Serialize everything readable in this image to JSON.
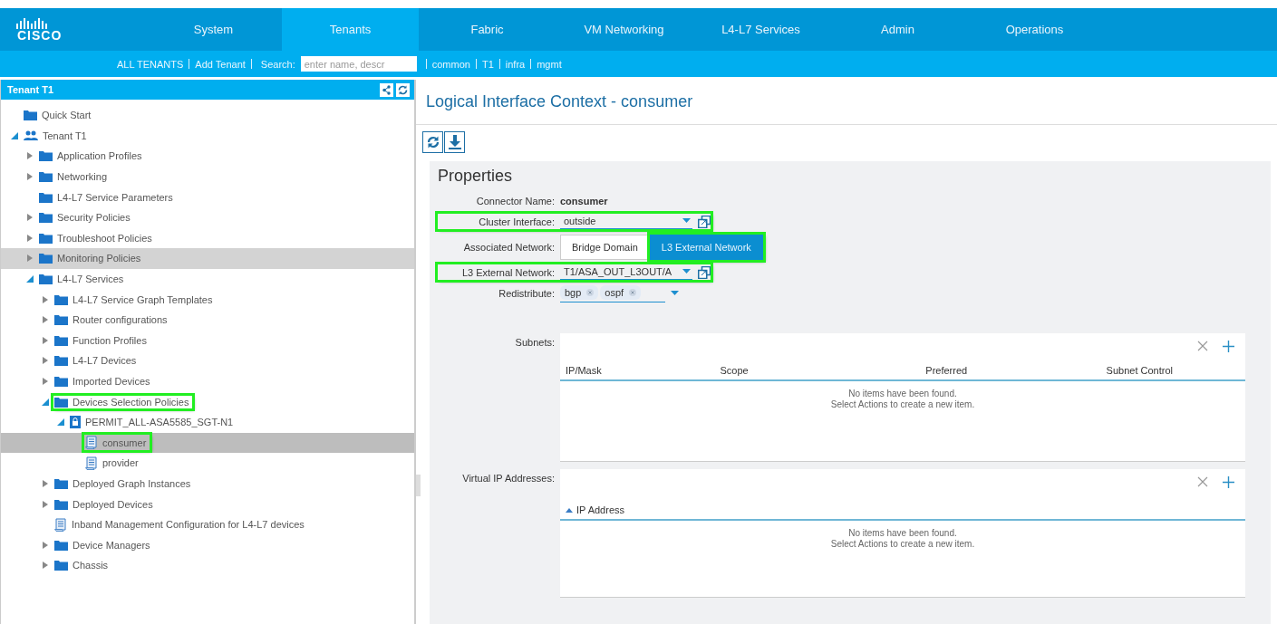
{
  "logo_text": "CISCO",
  "nav": [
    {
      "label": "System",
      "selected": false
    },
    {
      "label": "Tenants",
      "selected": true
    },
    {
      "label": "Fabric",
      "selected": false
    },
    {
      "label": "VM Networking",
      "selected": false
    },
    {
      "label": "L4-L7 Services",
      "selected": false
    },
    {
      "label": "Admin",
      "selected": false
    },
    {
      "label": "Operations",
      "selected": false
    }
  ],
  "subnav": {
    "links": [
      "ALL TENANTS",
      "Add Tenant"
    ],
    "search_label": "Search:",
    "search_placeholder": "enter name, descr",
    "tenants": [
      "common",
      "T1",
      "infra",
      "mgmt"
    ]
  },
  "sidebar": {
    "title": "Tenant T1",
    "tree": [
      {
        "label": "Quick Start",
        "kind": "folder",
        "selected": false,
        "hover": false,
        "highlighted": false
      },
      {
        "label": "Tenant T1",
        "kind": "tenant",
        "expanded": true,
        "selected": false,
        "hover": false,
        "highlighted": false,
        "children": [
          {
            "label": "Application Profiles",
            "kind": "folder",
            "expanded": false,
            "selected": false,
            "hover": false,
            "highlighted": false
          },
          {
            "label": "Networking",
            "kind": "folder",
            "expanded": false,
            "selected": false,
            "hover": false,
            "highlighted": false
          },
          {
            "label": "L4-L7 Service Parameters",
            "kind": "folder",
            "selected": false,
            "hover": false,
            "highlighted": false
          },
          {
            "label": "Security Policies",
            "kind": "folder",
            "expanded": false,
            "selected": false,
            "hover": false,
            "highlighted": false
          },
          {
            "label": "Troubleshoot Policies",
            "kind": "folder",
            "expanded": false,
            "selected": false,
            "hover": false,
            "highlighted": false
          },
          {
            "label": "Monitoring Policies",
            "kind": "folder",
            "expanded": false,
            "selected": false,
            "hover": true,
            "highlighted": false
          },
          {
            "label": "L4-L7 Services",
            "kind": "folder",
            "expanded": true,
            "selected": false,
            "hover": false,
            "highlighted": false,
            "children": [
              {
                "label": "L4-L7 Service Graph Templates",
                "kind": "folder",
                "expanded": false,
                "selected": false,
                "hover": false,
                "highlighted": false
              },
              {
                "label": "Router configurations",
                "kind": "folder",
                "expanded": false,
                "selected": false,
                "hover": false,
                "highlighted": false
              },
              {
                "label": "Function Profiles",
                "kind": "folder",
                "expanded": false,
                "selected": false,
                "hover": false,
                "highlighted": false
              },
              {
                "label": "L4-L7 Devices",
                "kind": "folder",
                "expanded": false,
                "selected": false,
                "hover": false,
                "highlighted": false
              },
              {
                "label": "Imported Devices",
                "kind": "folder",
                "expanded": false,
                "selected": false,
                "hover": false,
                "highlighted": false
              },
              {
                "label": "Devices Selection Policies",
                "kind": "folder",
                "expanded": true,
                "selected": false,
                "hover": false,
                "highlighted": true,
                "children": [
                  {
                    "label": "PERMIT_ALL-ASA5585_SGT-N1",
                    "kind": "policy",
                    "expanded": true,
                    "selected": false,
                    "hover": false,
                    "highlighted": false,
                    "children": [
                      {
                        "label": "consumer",
                        "kind": "doc",
                        "selected": true,
                        "hover": false,
                        "highlighted": true
                      },
                      {
                        "label": "provider",
                        "kind": "doc",
                        "selected": false,
                        "hover": false,
                        "highlighted": false
                      }
                    ]
                  }
                ]
              },
              {
                "label": "Deployed Graph Instances",
                "kind": "folder",
                "expanded": false,
                "selected": false,
                "hover": false,
                "highlighted": false
              },
              {
                "label": "Deployed Devices",
                "kind": "folder",
                "expanded": false,
                "selected": false,
                "hover": false,
                "highlighted": false
              },
              {
                "label": "Inband Management Configuration for L4-L7 devices",
                "kind": "doc",
                "selected": false,
                "hover": false,
                "highlighted": false
              },
              {
                "label": "Device Managers",
                "kind": "folder",
                "expanded": false,
                "selected": false,
                "hover": false,
                "highlighted": false
              },
              {
                "label": "Chassis",
                "kind": "folder",
                "expanded": false,
                "selected": false,
                "hover": false,
                "highlighted": false
              }
            ]
          }
        ]
      }
    ]
  },
  "main": {
    "title": "Logical Interface Context - consumer",
    "section": "Properties",
    "fields": [
      {
        "kind": "text",
        "label": "Connector Name:",
        "value": "consumer",
        "highlighted": false
      },
      {
        "kind": "dropdown",
        "label": "Cluster Interface:",
        "value": "outside",
        "highlighted": true
      },
      {
        "kind": "segmented",
        "label": "Associated Network:",
        "highlighted": false,
        "options": [
          {
            "label": "Bridge Domain",
            "selected": false,
            "highlighted": false
          },
          {
            "label": "L3 External Network",
            "selected": true,
            "highlighted": true
          }
        ]
      },
      {
        "kind": "dropdown",
        "label": "L3 External Network:",
        "value": "T1/ASA_OUT_L3OUT/A",
        "highlighted": true
      },
      {
        "kind": "tags",
        "label": "Redistribute:",
        "tags": [
          "bgp",
          "ospf"
        ],
        "highlighted": false
      }
    ],
    "tables": [
      {
        "label": "Subnets:",
        "columns": [
          {
            "label": "IP/Mask",
            "sorted": false
          },
          {
            "label": "Scope",
            "sorted": false
          },
          {
            "label": "Preferred",
            "sorted": false
          },
          {
            "label": "Subnet Control",
            "sorted": false
          }
        ],
        "empty_lines": [
          "No items have been found.",
          "Select Actions to create a new item."
        ]
      },
      {
        "label": "Virtual IP Addresses:",
        "columns": [
          {
            "label": "IP Address",
            "sorted": true
          }
        ],
        "empty_lines": [
          "No items have been found.",
          "Select Actions to create a new item."
        ]
      }
    ]
  }
}
